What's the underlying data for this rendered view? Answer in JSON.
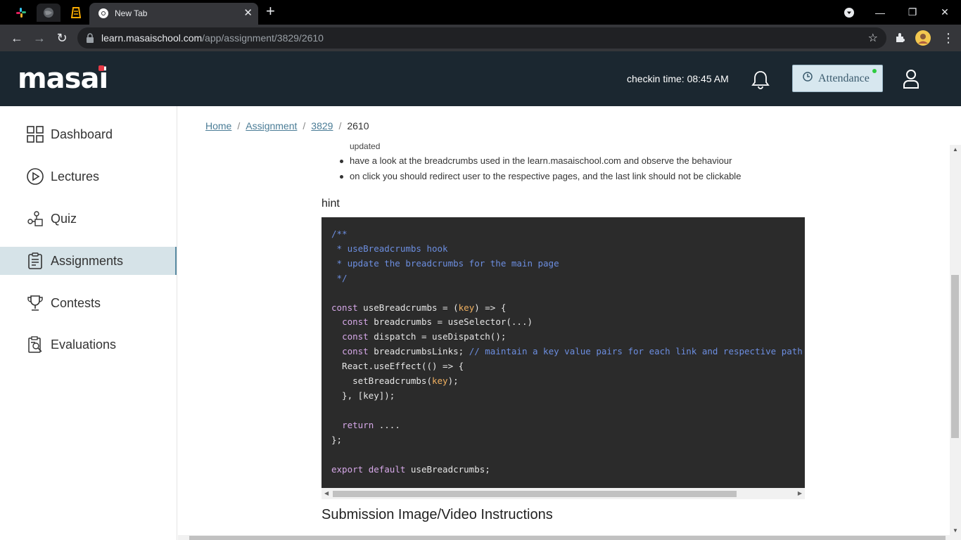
{
  "browser": {
    "tab_title": "New Tab",
    "url_host": "learn.masaischool.com",
    "url_path": "/app/assignment/3829/2610"
  },
  "header": {
    "logo": "masai",
    "checkin": "checkin time: 08:45 AM",
    "attendance_label": "Attendance"
  },
  "sidebar": {
    "items": [
      {
        "label": "Dashboard",
        "icon": "dashboard-icon"
      },
      {
        "label": "Lectures",
        "icon": "play-icon"
      },
      {
        "label": "Quiz",
        "icon": "quiz-icon"
      },
      {
        "label": "Assignments",
        "icon": "clipboard-icon",
        "active": true
      },
      {
        "label": "Contests",
        "icon": "trophy-icon"
      },
      {
        "label": "Evaluations",
        "icon": "evaluation-icon"
      }
    ]
  },
  "breadcrumb": {
    "items": [
      "Home",
      "Assignment",
      "3829"
    ],
    "current": "2610"
  },
  "content": {
    "cut_text": "updated",
    "bullets": [
      "have a look at the breadcrumbs used in the learn.masaischool.com and observe the behaviour",
      "on click you should redirect user to the respective pages, and the last link should not be clickable"
    ],
    "hint_label": "hint",
    "code_lines": [
      "/**",
      " * useBreadcrumbs hook",
      " * update the breadcrumbs for the main page",
      " */",
      "",
      "const useBreadcrumbs = (key) => {",
      "  const breadcrumbs = useSelector(...)",
      "  const dispatch = useDispatch();",
      "  const breadcrumbsLinks; // maintain a key value pairs for each link and respective path",
      "  React.useEffect(() => {",
      "    setBreadcrumbs(key);",
      "  }, [key]);",
      "",
      "  return ....",
      "};",
      "",
      "export default useBreadcrumbs;"
    ],
    "submission_heading": "Submission Image/Video Instructions"
  }
}
